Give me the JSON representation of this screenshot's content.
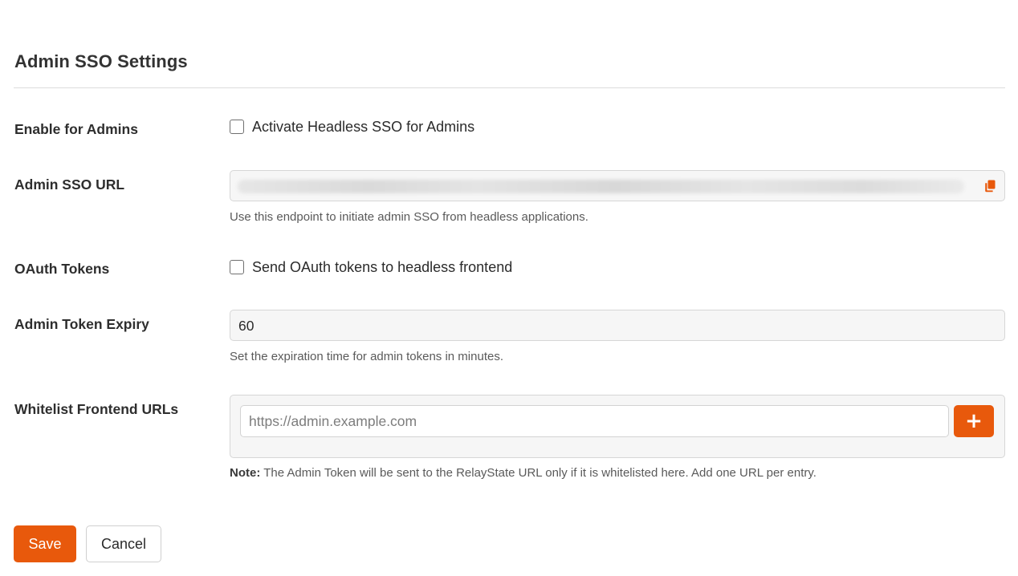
{
  "header": {
    "title": "Admin SSO Settings"
  },
  "fields": {
    "enable_admins": {
      "label": "Enable for Admins",
      "checkbox_label": "Activate Headless SSO for Admins",
      "checked": false
    },
    "sso_url": {
      "label": "Admin SSO URL",
      "help": "Use this endpoint to initiate admin SSO from headless applications.",
      "copy_icon": "copy-icon"
    },
    "oauth_tokens": {
      "label": "OAuth Tokens",
      "checkbox_label": "Send OAuth tokens to headless frontend",
      "checked": false
    },
    "token_expiry": {
      "label": "Admin Token Expiry",
      "value": "60",
      "help": "Set the expiration time for admin tokens in minutes."
    },
    "whitelist": {
      "label": "Whitelist Frontend URLs",
      "placeholder": "https://admin.example.com",
      "add_label": "+",
      "note_prefix": "Note:",
      "note": " The Admin Token will be sent to the RelayState URL only if it is whitelisted here. Add one URL per entry."
    }
  },
  "actions": {
    "save_label": "Save",
    "cancel_label": "Cancel"
  },
  "colors": {
    "accent": "#e8590c",
    "field_bg": "#f6f6f6",
    "border": "#d6d6d6"
  }
}
